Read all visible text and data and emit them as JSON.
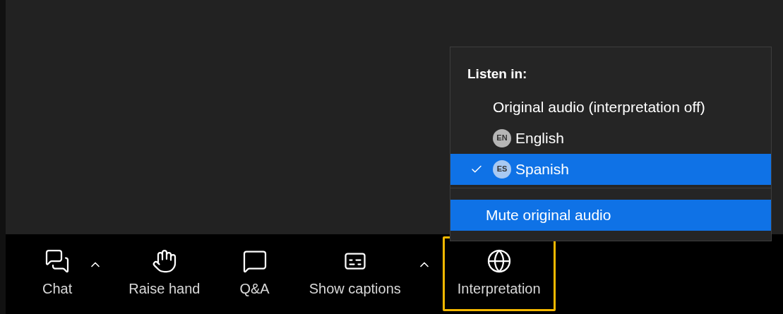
{
  "menu": {
    "heading": "Listen in:",
    "options": [
      {
        "label": "Original audio (interpretation off)",
        "selected": false
      },
      {
        "badge": "EN",
        "label": "English",
        "selected": false
      },
      {
        "badge": "ES",
        "label": "Spanish",
        "selected": true
      }
    ],
    "actions": [
      {
        "label": "Mute original audio",
        "highlighted": true
      }
    ]
  },
  "toolbar": [
    {
      "kind": "chat",
      "label": "Chat",
      "caret": true,
      "selected": false
    },
    {
      "kind": "hand",
      "label": "Raise hand",
      "caret": false,
      "selected": false
    },
    {
      "kind": "qa",
      "label": "Q&A",
      "caret": false,
      "selected": false
    },
    {
      "kind": "captions",
      "label": "Show captions",
      "caret": true,
      "selected": false
    },
    {
      "kind": "globe",
      "label": "Interpretation",
      "caret": false,
      "selected": true
    }
  ]
}
